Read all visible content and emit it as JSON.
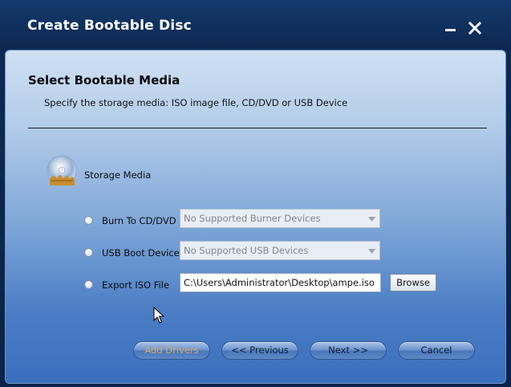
{
  "window": {
    "title": "Create Bootable Disc"
  },
  "header": {
    "title": "Select Bootable Media",
    "subtitle": "Specify the storage media: ISO image file, CD/DVD or USB Device"
  },
  "storage": {
    "label": "Storage Media",
    "icon": "cd-disc-icon"
  },
  "options": [
    {
      "label": "Burn To CD/DVD",
      "control": "dropdown",
      "value": "No Supported Burner Devices",
      "enabled": false
    },
    {
      "label": "USB Boot Device",
      "control": "dropdown",
      "value": "No Supported USB Devices",
      "enabled": false
    },
    {
      "label": "Export ISO File",
      "control": "text",
      "value": "C:\\Users\\Administrator\\Desktop\\ampe.iso",
      "enabled": true
    }
  ],
  "browse_label": "Browse",
  "footer": {
    "add_drivers": "Add Drivers",
    "previous": "<< Previous",
    "next": "Next >>",
    "cancel": "Cancel"
  },
  "colors": {
    "title_bar": "#0d2850",
    "panel_top": "#cfe0f3",
    "panel_bottom": "#3a6fbe",
    "disabled_text": "#d4a86a"
  }
}
